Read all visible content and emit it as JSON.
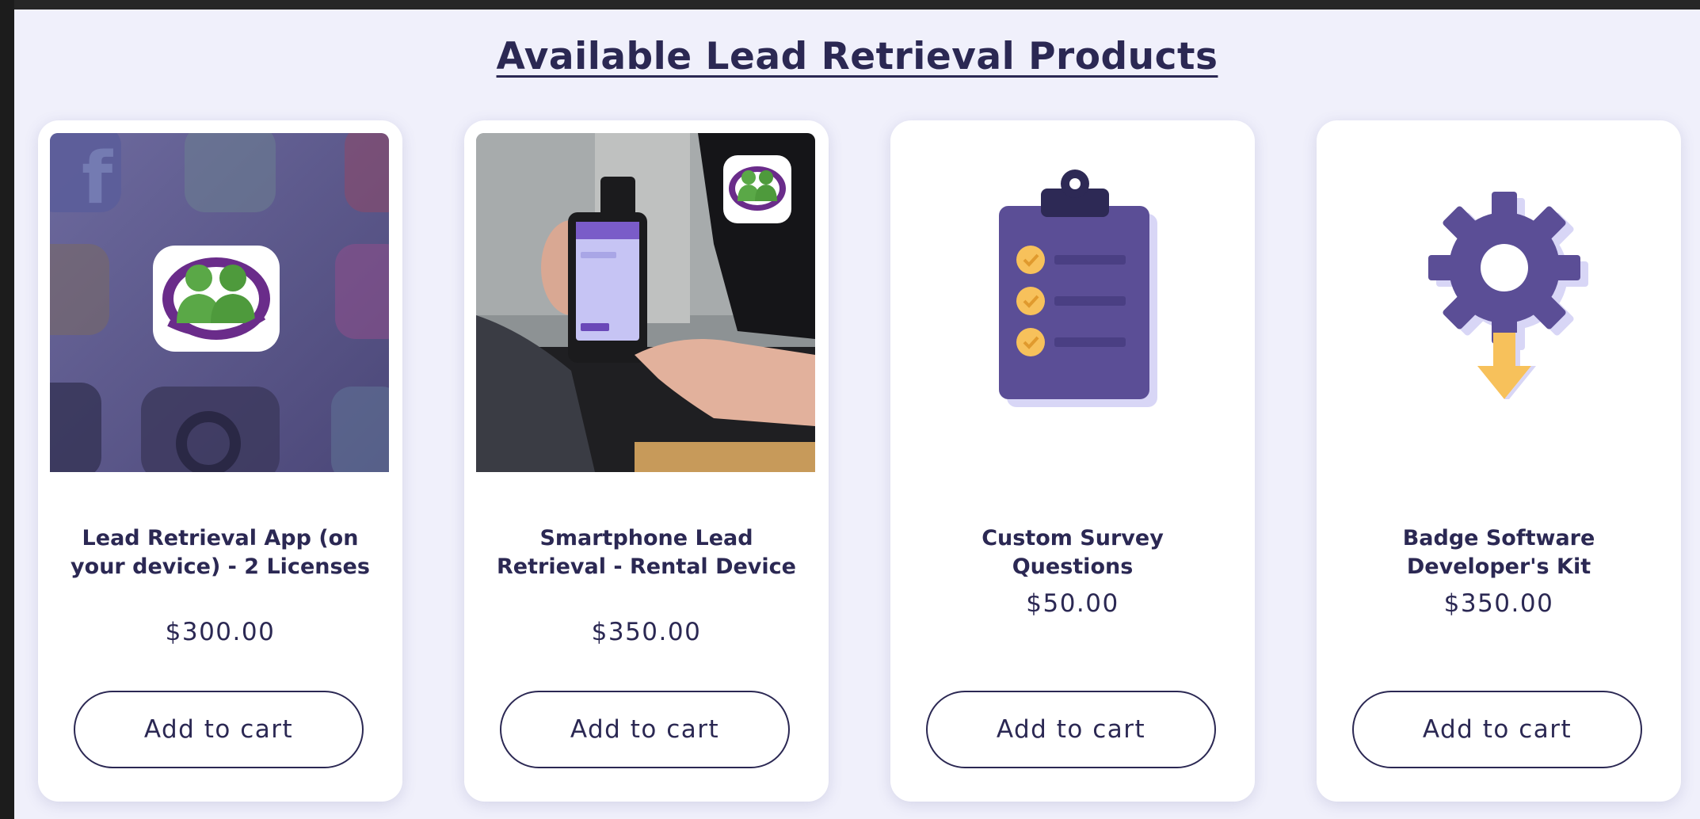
{
  "page": {
    "title": "Available Lead Retrieval Products"
  },
  "products": [
    {
      "title": "Lead Retrieval App (on your device) - 2 Licenses",
      "price": "$300.00",
      "button_label": "Add to cart",
      "image_icon": "app-logo-on-phone-screen"
    },
    {
      "title": "Smartphone Lead Retrieval - Rental Device",
      "price": "$350.00",
      "button_label": "Add to cart",
      "image_icon": "hand-holding-smartphone-photo"
    },
    {
      "title": "Custom Survey Questions",
      "price": "$50.00",
      "button_label": "Add to cart",
      "image_icon": "clipboard-checklist-icon"
    },
    {
      "title": "Badge Software Developer's Kit",
      "price": "$350.00",
      "button_label": "Add to cart",
      "image_icon": "gear-download-icon"
    }
  ],
  "colors": {
    "page_background": "#f0f0fb",
    "text": "#2b2853",
    "icon_purple": "#5b4e96",
    "icon_yellow": "#f7c15b",
    "logo_green": "#5aa847",
    "logo_purple": "#6a2c8a"
  }
}
